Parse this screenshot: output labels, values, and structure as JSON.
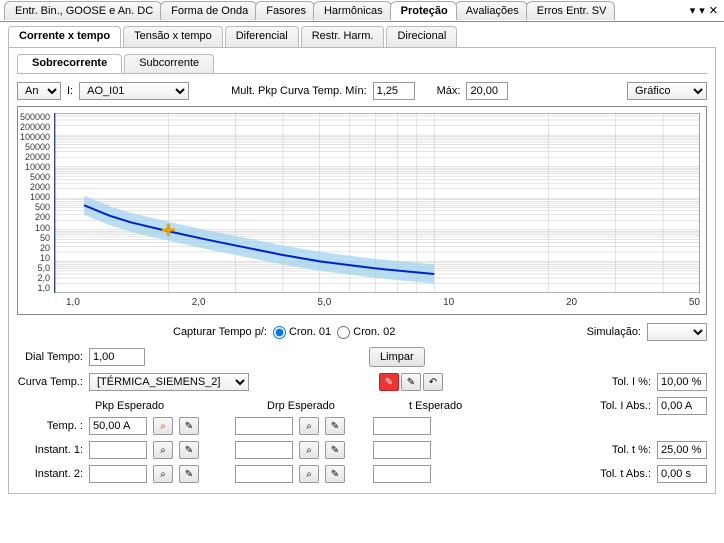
{
  "top_tabs": {
    "t0": "Entr. Bin., GOOSE e An. DC",
    "t1": "Forma de Onda",
    "t2": "Fasores",
    "t3": "Harmônicas",
    "t4": "Proteção",
    "t5": "Avaliações",
    "t6": "Erros Entr. SV"
  },
  "window_controls": {
    "pin": "▾",
    "min": "▾",
    "close": "✕"
  },
  "sub1": {
    "s0": "Corrente x tempo",
    "s1": "Tensão x tempo",
    "s2": "Diferencial",
    "s3": "Restr. Harm.",
    "s4": "Direcional"
  },
  "sub2": {
    "s0": "Sobrecorrente",
    "s1": "Subcorrente"
  },
  "top_row": {
    "unit_options": "An",
    "i_lbl": "I:",
    "i_sel": "AO_I01",
    "mult_lbl": "Mult. Pkp Curva Temp. Mín:",
    "mult_min": "1,25",
    "max_lbl": "Máx:",
    "mult_max": "20,00",
    "view_lbl": "Gráfico"
  },
  "chart_data": {
    "type": "line",
    "xscale": "log",
    "yscale": "log",
    "xlim": [
      1,
      50
    ],
    "ylim": [
      1,
      500000
    ],
    "y_ticks": [
      "500000",
      "200000",
      "100000",
      "50000",
      "20000",
      "10000",
      "5000",
      "2000",
      "1000",
      "500",
      "200",
      "100",
      "50",
      "20",
      "10",
      "5,0",
      "2,0",
      "1,0"
    ],
    "x_ticks": [
      "1,0",
      "2,0",
      "5,0",
      "10",
      "20",
      "50"
    ],
    "vertical_line_x": 1.0,
    "series": [
      {
        "name": "curve",
        "x": [
          1.2,
          1.4,
          1.6,
          2.0,
          2.5,
          3.0,
          4.0,
          5.0,
          7.0,
          10.0
        ],
        "y": [
          600,
          280,
          170,
          90,
          50,
          32,
          16,
          10,
          6,
          4
        ]
      }
    ],
    "tolerance_band": true,
    "marker": {
      "x": 2.0,
      "y": 100
    }
  },
  "mid_row": {
    "capture_lbl": "Capturar Tempo p/:",
    "cron1": "Cron. 01",
    "cron2": "Cron. 02",
    "sim_lbl": "Simulação:"
  },
  "form": {
    "dial_tempo_lbl": "Dial Tempo:",
    "dial_tempo": "1,00",
    "limpar": "Limpar",
    "curva_lbl": "Curva Temp.:",
    "curva_val": "[TÉRMICA_SIEMENS_2]",
    "tol_i_lbl": "Tol. I %:",
    "tol_i": "10,00 %",
    "pkp_hdr": "Pkp Esperado",
    "drp_hdr": "Drp Esperado",
    "t_hdr": "t Esperado",
    "tol_i_abs_lbl": "Tol. I Abs.:",
    "tol_i_abs": "0,00 A",
    "temp_lbl": "Temp. :",
    "temp_val": "50,00 A",
    "inst1_lbl": "Instant. 1:",
    "inst2_lbl": "Instant. 2:",
    "tol_t_lbl": "Tol. t %:",
    "tol_t": "25,00 %",
    "tol_t_abs_lbl": "Tol. t Abs.:",
    "tol_t_abs": "0,00 s"
  }
}
